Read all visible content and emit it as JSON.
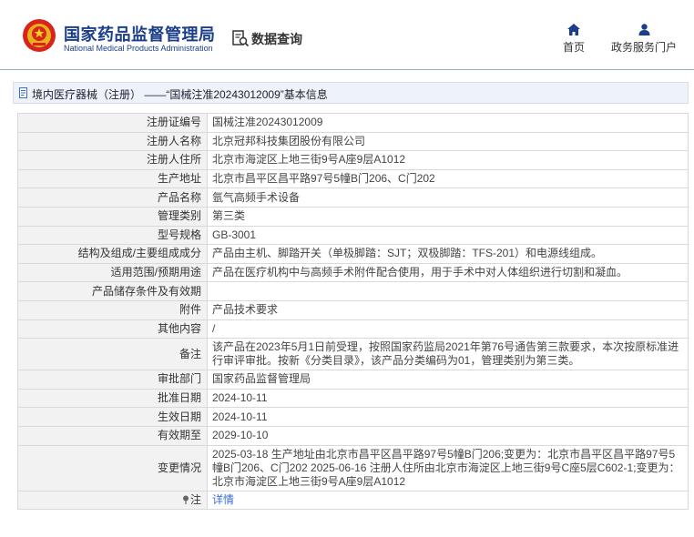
{
  "header": {
    "brand_cn": "国家药品监督管理局",
    "brand_en": "National Medical Products Administration",
    "section_title": "数据查询",
    "nav": [
      {
        "label": "首页",
        "icon": "home-icon"
      },
      {
        "label": "政务服务门户",
        "icon": "user-icon"
      }
    ]
  },
  "breadcrumb": {
    "text": "境内医疗器械（注册） ——“国械注准20243012009”基本信息"
  },
  "rows": [
    {
      "label": "注册证编号",
      "value": "国械注准20243012009"
    },
    {
      "label": "注册人名称",
      "value": "北京冠邦科技集团股份有限公司"
    },
    {
      "label": "注册人住所",
      "value": "北京市海淀区上地三街9号A座9层A1012"
    },
    {
      "label": "生产地址",
      "value": "北京市昌平区昌平路97号5幢B门206、C门202"
    },
    {
      "label": "产品名称",
      "value": "氩气高频手术设备"
    },
    {
      "label": "管理类别",
      "value": "第三类"
    },
    {
      "label": "型号规格",
      "value": "GB-3001"
    },
    {
      "label": "结构及组成/主要组成成分",
      "value": "产品由主机、脚踏开关（单极脚踏：SJT；双极脚踏：TFS-201）和电源线组成。"
    },
    {
      "label": "适用范围/预期用途",
      "value": "产品在医疗机构中与高频手术附件配合使用，用于手术中对人体组织进行切割和凝血。"
    },
    {
      "label": "产品储存条件及有效期",
      "value": ""
    },
    {
      "label": "附件",
      "value": "产品技术要求"
    },
    {
      "label": "其他内容",
      "value": "/"
    },
    {
      "label": "备注",
      "value": "该产品在2023年5月1日前受理，按照国家药监局2021年第76号通告第三款要求，本次按原标准进行审评审批。按新《分类目录》，该产品分类编码为01，管理类别为第三类。"
    },
    {
      "label": "审批部门",
      "value": "国家药品监督管理局"
    },
    {
      "label": "批准日期",
      "value": "2024-10-11"
    },
    {
      "label": "生效日期",
      "value": "2024-10-11"
    },
    {
      "label": "有效期至",
      "value": "2029-10-10"
    },
    {
      "label": "变更情况",
      "value": "2025-03-18 生产地址由北京市昌平区昌平路97号5幢B门206;变更为：北京市昌平区昌平路97号5幢B门206、C门202 2025-06-16 注册人住所由北京市海淀区上地三街9号C座5层C602-1;变更为：北京市海淀区上地三街9号A座9层A1012"
    }
  ],
  "footer_row": {
    "label": "注",
    "link": "详情"
  }
}
